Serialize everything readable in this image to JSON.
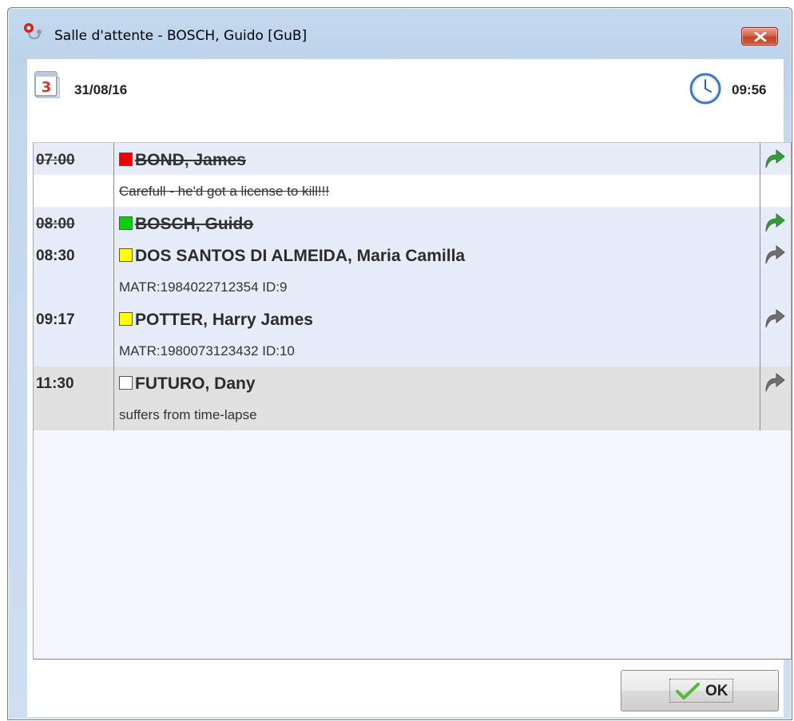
{
  "window": {
    "title": "Salle d'attente - BOSCH, Guido [GuB]",
    "close_icon": "close-x-icon"
  },
  "header": {
    "date": "31/08/16",
    "date_icon": "calendar-icon",
    "time": "09:56",
    "time_icon": "clock-icon"
  },
  "colors": {
    "status_red": "#ee0000",
    "status_green": "#11cc11",
    "status_yellow": "#ffff00",
    "status_empty": "#ffffff",
    "arrow_green": "#3a9b3a",
    "arrow_grey": "#707070"
  },
  "appointments": [
    {
      "time": "07:00",
      "name": "BOND, James",
      "status": "red",
      "done": true,
      "note": "Carefull - he'd got a license to kill!!!",
      "arrow": "green"
    },
    {
      "time": "08:00",
      "name": "BOSCH, Guido",
      "status": "green",
      "done": true,
      "note": "",
      "arrow": "green"
    },
    {
      "time": "08:30",
      "name": "DOS SANTOS DI ALMEIDA, Maria Camilla",
      "status": "yellow",
      "done": false,
      "note": "MATR:1984022712354 ID:9",
      "arrow": "grey"
    },
    {
      "time": "09:17",
      "name": "POTTER, Harry James",
      "status": "yellow",
      "done": false,
      "note": "MATR:1980073123432 ID:10",
      "arrow": "grey"
    },
    {
      "time": "11:30",
      "name": "FUTURO, Dany",
      "status": "empty",
      "done": false,
      "note": "suffers from time-lapse",
      "arrow": "grey"
    }
  ],
  "footer": {
    "ok_label": "OK",
    "ok_icon": "checkmark-icon"
  }
}
